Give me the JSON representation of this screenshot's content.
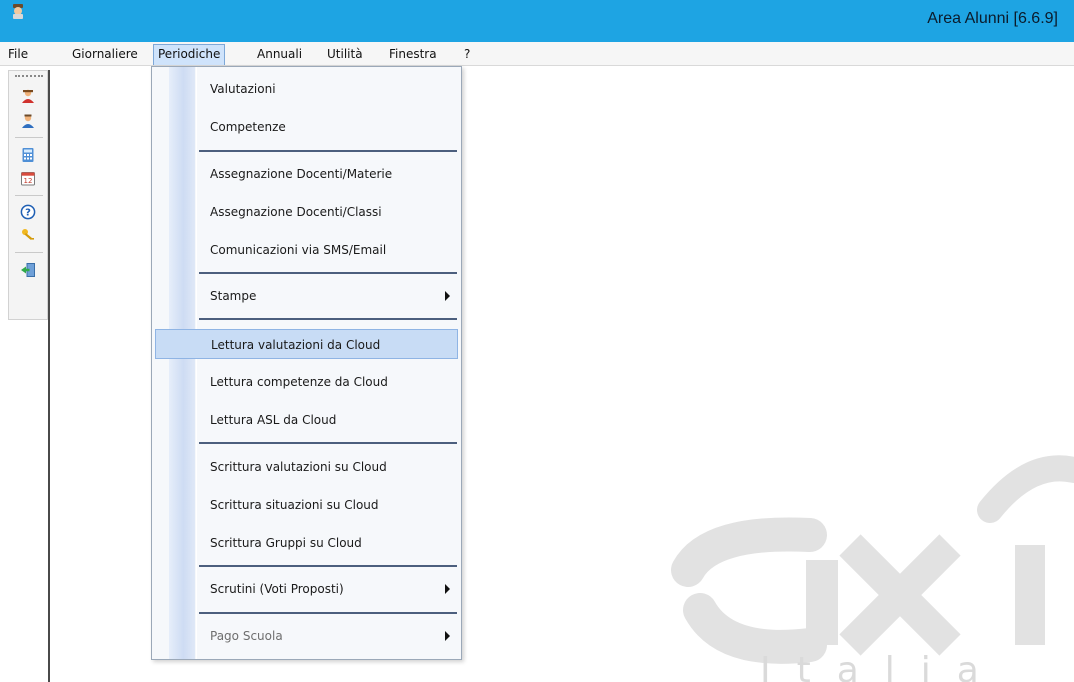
{
  "window": {
    "title": "Area Alunni [6.6.9]"
  },
  "menubar": {
    "items": [
      "File",
      "Giornaliere",
      "Periodiche",
      "Annuali",
      "Utilità",
      "Finestra",
      "?"
    ]
  },
  "toolbar": {
    "icons": [
      "student-icon",
      "teacher-icon",
      "calculator-icon",
      "calendar-icon",
      "help-icon",
      "keys-icon",
      "exit-icon"
    ]
  },
  "dropdown": {
    "items": [
      {
        "label": "Valutazioni"
      },
      {
        "label": "Competenze"
      },
      {
        "label": "Assegnazione Docenti/Materie"
      },
      {
        "label": "Assegnazione Docenti/Classi"
      },
      {
        "label": "Comunicazioni via SMS/Email"
      },
      {
        "label": "Stampe"
      },
      {
        "label": "Lettura valutazioni da Cloud"
      },
      {
        "label": "Lettura competenze da Cloud"
      },
      {
        "label": "Lettura ASL da Cloud"
      },
      {
        "label": "Scrittura valutazioni su Cloud"
      },
      {
        "label": "Scrittura situazioni su Cloud"
      },
      {
        "label": "Scrittura Gruppi su Cloud"
      },
      {
        "label": "Scrutini (Voti Proposti)"
      },
      {
        "label": "Pago Scuola"
      }
    ]
  },
  "watermark": {
    "tagline": "Italia"
  },
  "colors": {
    "titlebar": "#1ea4e3",
    "menu_highlight": "#c8dcf5",
    "separator": "#4c5f7e"
  }
}
